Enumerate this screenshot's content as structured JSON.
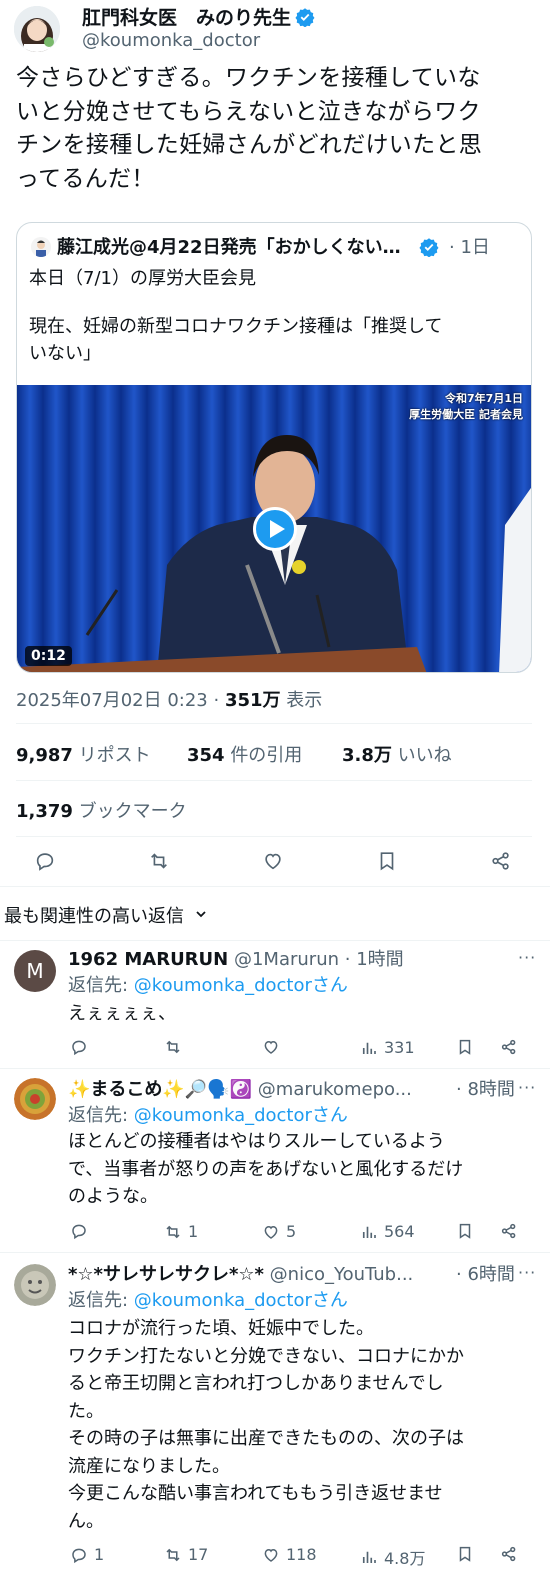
{
  "tweet": {
    "author_name": "肛門科女医　みのり先生",
    "author_handle": "@koumonka_doctor",
    "text_lines": [
      "今さらひどすぎる。ワクチンを接種していな",
      "いと分娩させてもらえないと泣きながらワク",
      "チンを接種した妊婦さんがどれだけいたと思",
      "ってるんだ！"
    ],
    "quote": {
      "name": "藤江成光@4月22日発売「おかしくない…",
      "time": "· 1日",
      "line1": "本日（7/1）の厚労大臣会見",
      "line2": "現在、妊婦の新型コロナワクチン接種は「推奨して",
      "line3": "いない」",
      "video_caption_1": "令和7年7月1日",
      "video_caption_2": "厚生労働大臣 記者会見",
      "video_duration": "0:12"
    },
    "timestamp": "2025年07月02日 0:23 · ",
    "views_value": "351万",
    "views_label": " 表示",
    "stats": {
      "reposts_value": "9,987",
      "reposts_label": "リポスト",
      "quotes_value": "354",
      "quotes_label": "件の引用",
      "likes_value": "3.8万",
      "likes_label": "いいね",
      "bookmarks_value": "1,379",
      "bookmarks_label": "ブックマーク"
    }
  },
  "sort": {
    "label": "最も関連性の高い返信",
    "chevron": "chevron-down-icon"
  },
  "replies": [
    {
      "name": "1962 MARURUN",
      "handle": "@1Marurun",
      "time": "· 1時間",
      "reply_prefix": "返信先: ",
      "reply_handle": "@koumonka_doctorさん",
      "text_lines": [
        "えぇぇぇぇ、"
      ],
      "avatar_letter": "M",
      "replies_count": "",
      "reposts_count": "",
      "likes_count": "",
      "views_count": "331"
    },
    {
      "name": "✨まるこめ✨🔎🗣️☯️",
      "handle": "@marukomepo...",
      "time": "· 8時間",
      "reply_prefix": "返信先: ",
      "reply_handle": "@koumonka_doctorさん",
      "text_lines": [
        "ほとんどの接種者はやはりスルーしているよう",
        "で、当事者が怒りの声をあげないと風化するだけ",
        "のような。"
      ],
      "replies_count": "",
      "reposts_count": "1",
      "likes_count": "5",
      "views_count": "564"
    },
    {
      "name": "*☆*サレサレサクレ*☆*",
      "handle": "@nico_YouTub...",
      "time": "· 6時間",
      "reply_prefix": "返信先: ",
      "reply_handle": "@koumonka_doctorさん",
      "text_lines": [
        "コロナが流行った頃、妊娠中でした。",
        "ワクチン打たないと分娩できない、コロナにかか",
        "ると帝王切開と言われ打つしかありませんでし",
        "た。",
        "その時の子は無事に出産できたものの、次の子は",
        "流産になりました。",
        "今更こんな酷い事言われてももう引き返せませ",
        "ん。"
      ],
      "replies_count": "1",
      "reposts_count": "17",
      "likes_count": "118",
      "views_count": "4.8万"
    }
  ],
  "colors": {
    "accent": "#1d9bf0",
    "text": "#0f1419",
    "secondary": "#536471",
    "border": "#cfd9de",
    "curtain": "#1742a8"
  }
}
